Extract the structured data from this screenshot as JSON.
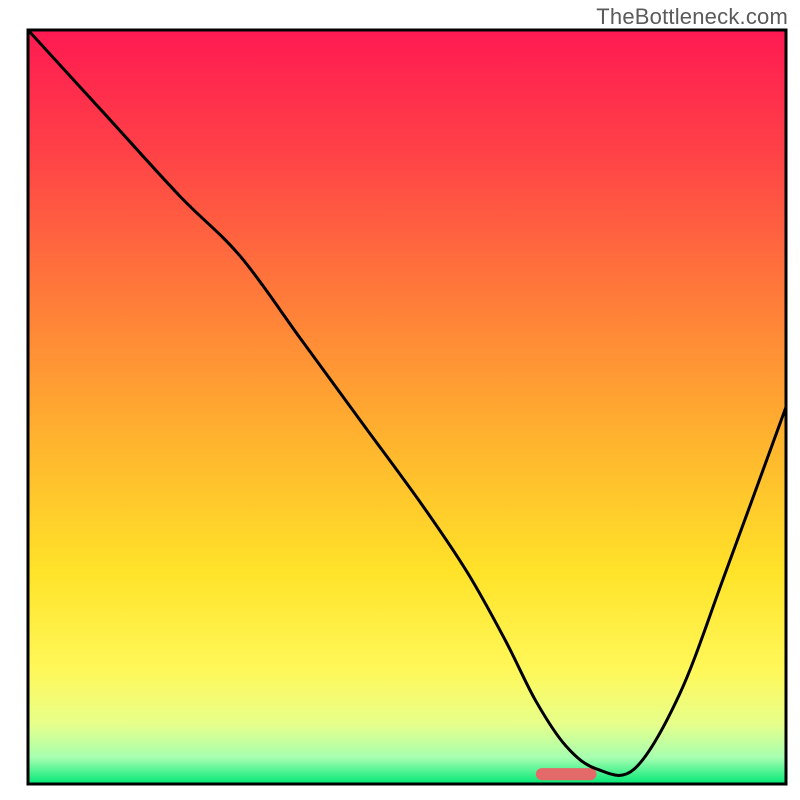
{
  "watermark": "TheBottleneck.com",
  "chart_data": {
    "type": "line",
    "title": "",
    "xlabel": "",
    "ylabel": "",
    "xlim": [
      0,
      100
    ],
    "ylim": [
      0,
      100
    ],
    "grid": false,
    "legend": false,
    "annotations": [],
    "background": {
      "kind": "vertical-gradient",
      "stops": [
        {
          "pos": 0.0,
          "color": "#ff1a52"
        },
        {
          "pos": 0.15,
          "color": "#ff3e48"
        },
        {
          "pos": 0.35,
          "color": "#ff7a3a"
        },
        {
          "pos": 0.55,
          "color": "#ffb52e"
        },
        {
          "pos": 0.72,
          "color": "#ffe329"
        },
        {
          "pos": 0.85,
          "color": "#fff85a"
        },
        {
          "pos": 0.92,
          "color": "#e7ff8a"
        },
        {
          "pos": 0.965,
          "color": "#a6ffb0"
        },
        {
          "pos": 1.0,
          "color": "#00e876"
        }
      ]
    },
    "series": [
      {
        "name": "bottleneck-curve",
        "color": "#000000",
        "x": [
          0,
          10,
          20,
          28,
          36,
          44,
          52,
          58,
          63,
          67,
          71,
          75,
          80,
          86,
          92,
          100
        ],
        "y": [
          100,
          89,
          78,
          70,
          59,
          48,
          37,
          28,
          19,
          11,
          5,
          2,
          2,
          12,
          28,
          50
        ]
      }
    ],
    "marker": {
      "name": "optimal-zone",
      "color": "#e46a6a",
      "x_center": 71,
      "y": 1.3,
      "width_x": 8,
      "height_y": 1.6
    }
  }
}
